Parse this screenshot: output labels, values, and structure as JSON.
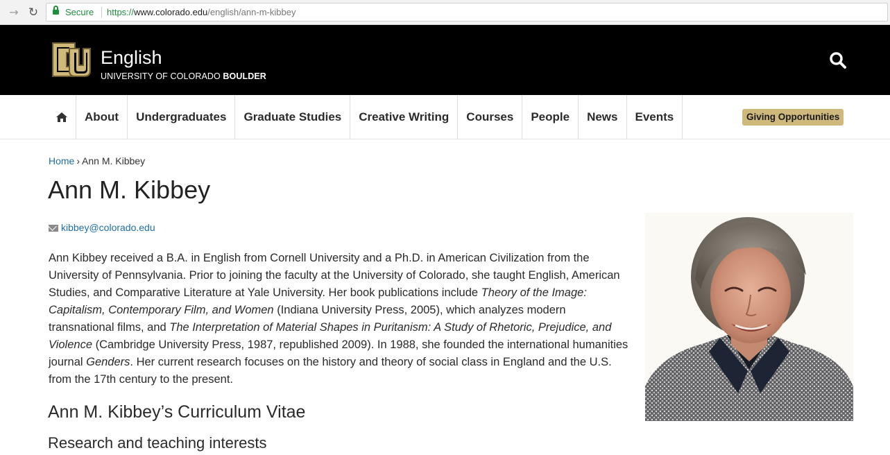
{
  "browser": {
    "secure_label": "Secure",
    "url_scheme": "https://",
    "url_host": "www.colorado.edu",
    "url_path": "/english/ann-m-kibbey"
  },
  "header": {
    "title": "English",
    "subtitle_prefix": "UNIVERSITY OF COLORADO",
    "subtitle_bold": "BOULDER",
    "brand_color": "#000000",
    "logo_color": "#cfb87c"
  },
  "nav": {
    "home_icon": "home-icon",
    "items": [
      {
        "label": "About"
      },
      {
        "label": "Undergraduates"
      },
      {
        "label": "Graduate Studies"
      },
      {
        "label": "Creative Writing"
      },
      {
        "label": "Courses"
      },
      {
        "label": "People"
      },
      {
        "label": "News"
      },
      {
        "label": "Events"
      }
    ],
    "giving_label": "Giving Opportunities",
    "giving_color": "#cfb87c"
  },
  "breadcrumb": {
    "home": "Home",
    "separator": "›",
    "current": "Ann M. Kibbey"
  },
  "profile": {
    "name": "Ann M. Kibbey",
    "email": "kibbey@colorado.edu",
    "bio": {
      "p1": "Ann Kibbey received a B.A. in English from Cornell University and a Ph.D. in American Civilization from the University of Pennsylvania.  Prior to joining the faculty at the University of Colorado, she taught English, American Studies, and Comparative Literature at Yale University.  Her book publications include ",
      "book1": "Theory of the Image: Capitalism, Contemporary Film, and Women",
      "p2": " (Indiana University Press, 2005), which analyzes modern transnational films, and ",
      "book2": "The Interpretation of Material Shapes in Puritanism: A Study of Rhetoric, Prejudice, and Violence",
      "p3": " (Cambridge University Press, 1987, republished 2009). In 1988, she founded the international humanities journal ",
      "journal": "Genders",
      "p4": ". Her current research focuses on the history and theory of social class in England and the U.S. from the 17th century to the present."
    },
    "cv_heading": "Ann M. Kibbey’s Curriculum Vitae",
    "research_heading": "Research and teaching interests"
  }
}
